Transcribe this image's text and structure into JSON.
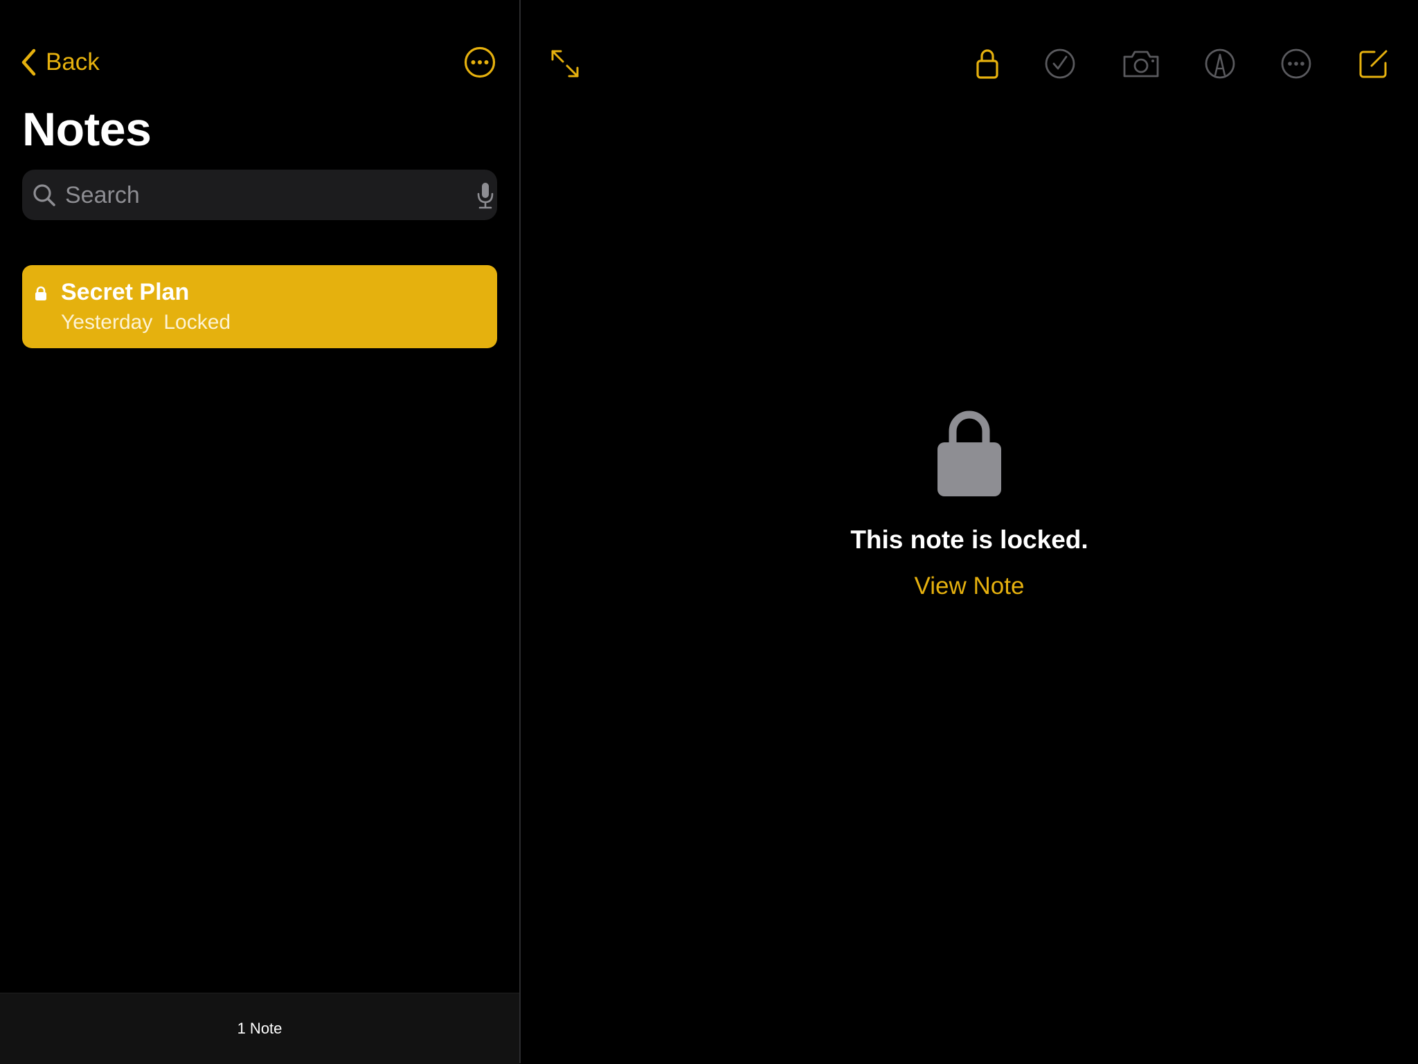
{
  "colors": {
    "accent": "#e6b10e",
    "selected_row": "#e5b10e",
    "background": "#000000",
    "search_field": "#1c1c1e",
    "disabled_icon": "#5a5a5e",
    "lock_gray": "#8e8e93"
  },
  "sidebar": {
    "back_label": "Back",
    "more_icon": "ellipsis-circle-icon",
    "title": "Notes",
    "search": {
      "placeholder": "Search",
      "value": ""
    },
    "notes": [
      {
        "title": "Secret Plan",
        "date": "Yesterday",
        "status": "Locked",
        "locked": true,
        "selected": true
      }
    ],
    "footer_count": "1 Note"
  },
  "toolbar": {
    "left": [
      "expand-icon"
    ],
    "right": [
      "lock-icon",
      "checklist-icon",
      "camera-icon",
      "markup-icon",
      "ellipsis-circle-icon",
      "compose-icon"
    ]
  },
  "detail": {
    "message": "This note is locked.",
    "action_label": "View Note"
  }
}
